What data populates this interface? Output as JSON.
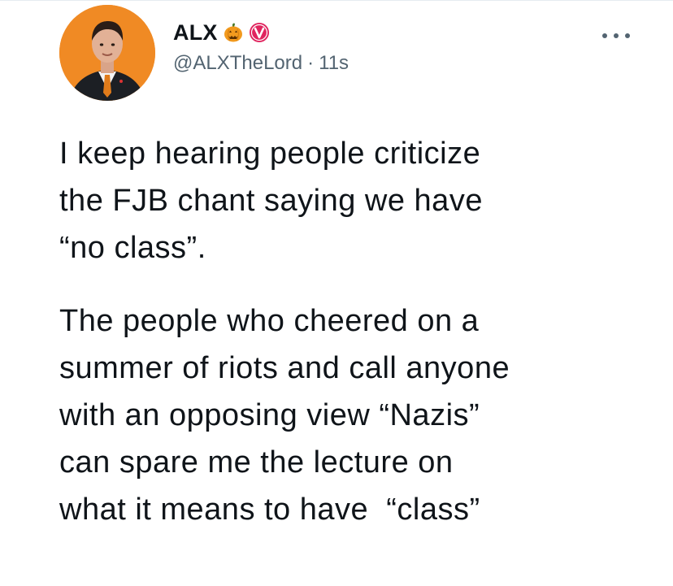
{
  "tweet": {
    "author": {
      "display_name": "ALX",
      "handle": "@ALXTheLord",
      "timestamp": "11s",
      "separator": "·",
      "emoji_icon": "pumpkin-icon",
      "badge_icon": "verified-v-icon",
      "avatar_bg": "#F08A24"
    },
    "more_icon": "more-dots-icon",
    "paragraphs": [
      {
        "lines": [
          "I keep hearing people criticize",
          "the FJB chant saying we have",
          "“no class”."
        ]
      },
      {
        "lines": [
          "The people who cheered on a",
          "summer of riots and call anyone",
          "with an opposing view “Nazis”",
          "can spare me the lecture on",
          "what it means to have  “class”"
        ]
      }
    ]
  },
  "colors": {
    "text_primary": "#0F1419",
    "text_secondary": "#536471",
    "badge_red": "#E0245E",
    "pumpkin_orange": "#F29A1E"
  }
}
